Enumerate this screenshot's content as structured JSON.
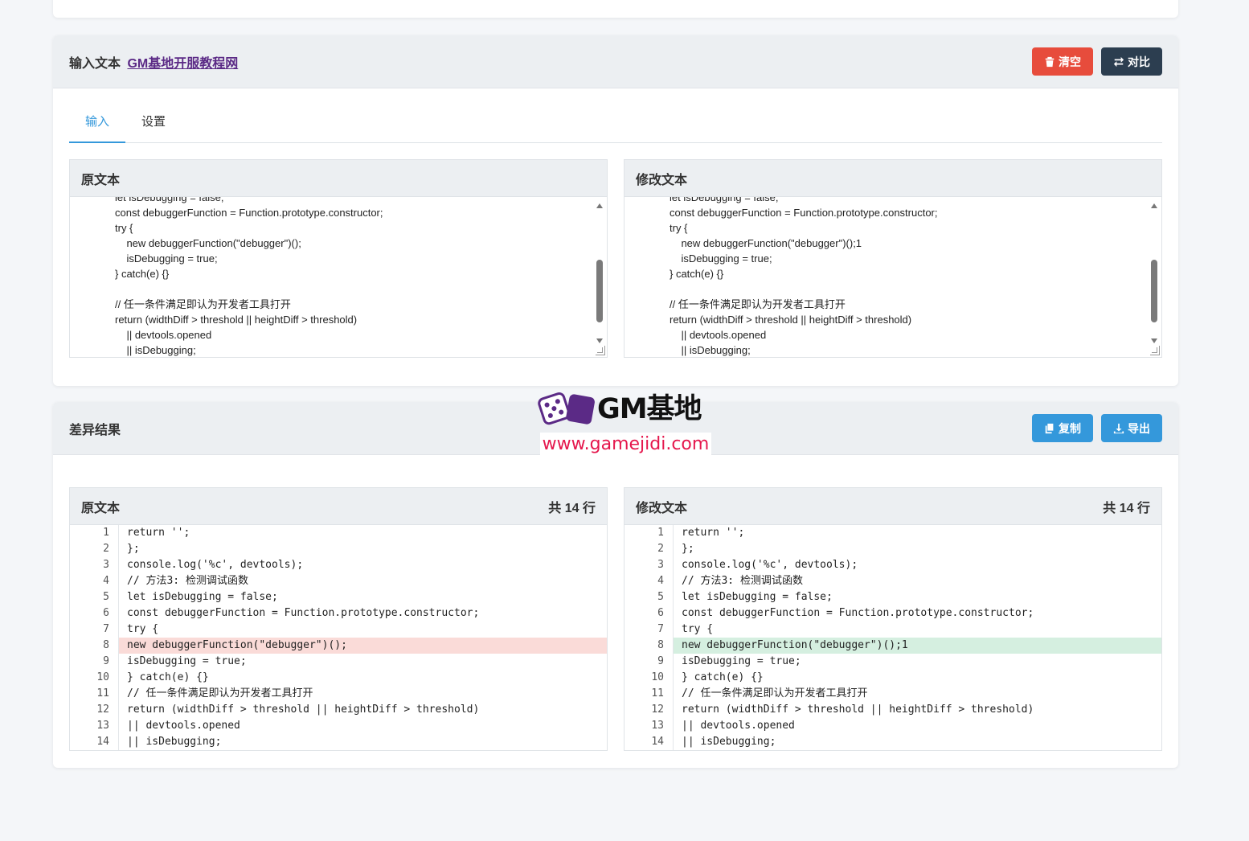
{
  "input_card": {
    "title": "输入文本",
    "link": "GM基地开服教程网",
    "clear_label": "清空",
    "compare_label": "对比",
    "tabs": [
      {
        "label": "输入"
      },
      {
        "label": "设置"
      }
    ],
    "left": {
      "title": "原文本",
      "lines": [
        "let isDebugging = false;",
        "const debuggerFunction = Function.prototype.constructor;",
        "try {",
        "    new debuggerFunction(\"debugger\")();",
        "    isDebugging = true;",
        "} catch(e) {}",
        "",
        "// 任一条件满足即认为开发者工具打开",
        "return (widthDiff > threshold || heightDiff > threshold)",
        "    || devtools.opened",
        "    || isDebugging;"
      ]
    },
    "right": {
      "title": "修改文本",
      "lines": [
        "let isDebugging = false;",
        "const debuggerFunction = Function.prototype.constructor;",
        "try {",
        "    new debuggerFunction(\"debugger\")();1",
        "    isDebugging = true;",
        "} catch(e) {}",
        "",
        "// 任一条件满足即认为开发者工具打开",
        "return (widthDiff > threshold || heightDiff > threshold)",
        "    || devtools.opened",
        "    || isDebugging;"
      ]
    }
  },
  "diff_card": {
    "title": "差异结果",
    "copy_label": "复制",
    "export_label": "导出",
    "left": {
      "title": "原文本",
      "count": "共 14 行",
      "rows": [
        {
          "n": "1",
          "text": "return '';",
          "type": ""
        },
        {
          "n": "2",
          "text": "};",
          "type": ""
        },
        {
          "n": "3",
          "text": "console.log('%c', devtools);",
          "type": ""
        },
        {
          "n": "4",
          "text": "// 方法3: 检测调试函数",
          "type": ""
        },
        {
          "n": "5",
          "text": "let isDebugging = false;",
          "type": ""
        },
        {
          "n": "6",
          "text": "const debuggerFunction = Function.prototype.constructor;",
          "type": ""
        },
        {
          "n": "7",
          "text": "try {",
          "type": ""
        },
        {
          "n": "8",
          "text": "new debuggerFunction(\"debugger\")();",
          "type": "del"
        },
        {
          "n": "9",
          "text": "isDebugging = true;",
          "type": ""
        },
        {
          "n": "10",
          "text": "} catch(e) {}",
          "type": ""
        },
        {
          "n": "11",
          "text": "// 任一条件满足即认为开发者工具打开",
          "type": ""
        },
        {
          "n": "12",
          "text": "return (widthDiff > threshold || heightDiff > threshold)",
          "type": ""
        },
        {
          "n": "13",
          "text": "|| devtools.opened",
          "type": ""
        },
        {
          "n": "14",
          "text": "|| isDebugging;",
          "type": ""
        }
      ]
    },
    "right": {
      "title": "修改文本",
      "count": "共 14 行",
      "rows": [
        {
          "n": "1",
          "text": "return '';",
          "type": ""
        },
        {
          "n": "2",
          "text": "};",
          "type": ""
        },
        {
          "n": "3",
          "text": "console.log('%c', devtools);",
          "type": ""
        },
        {
          "n": "4",
          "text": "// 方法3: 检测调试函数",
          "type": ""
        },
        {
          "n": "5",
          "text": "let isDebugging = false;",
          "type": ""
        },
        {
          "n": "6",
          "text": "const debuggerFunction = Function.prototype.constructor;",
          "type": ""
        },
        {
          "n": "7",
          "text": "try {",
          "type": ""
        },
        {
          "n": "8",
          "text": "new debuggerFunction(\"debugger\")();1",
          "type": "add"
        },
        {
          "n": "9",
          "text": "isDebugging = true;",
          "type": ""
        },
        {
          "n": "10",
          "text": "} catch(e) {}",
          "type": ""
        },
        {
          "n": "11",
          "text": "// 任一条件满足即认为开发者工具打开",
          "type": ""
        },
        {
          "n": "12",
          "text": "return (widthDiff > threshold || heightDiff > threshold)",
          "type": ""
        },
        {
          "n": "13",
          "text": "|| devtools.opened",
          "type": ""
        },
        {
          "n": "14",
          "text": "|| isDebugging;",
          "type": ""
        }
      ]
    }
  },
  "watermark": {
    "brand": "GM基地",
    "url": "www.gamejidi.com"
  },
  "colors": {
    "danger": "#e74c3c",
    "dark": "#2c3e50",
    "primary": "#3498db",
    "deleted_bg": "#fadbd8",
    "added_bg": "#d5efe0"
  },
  "icons": [
    "trash-icon",
    "swap-icon",
    "copy-icon",
    "download-icon",
    "dice-logo-icon"
  ]
}
